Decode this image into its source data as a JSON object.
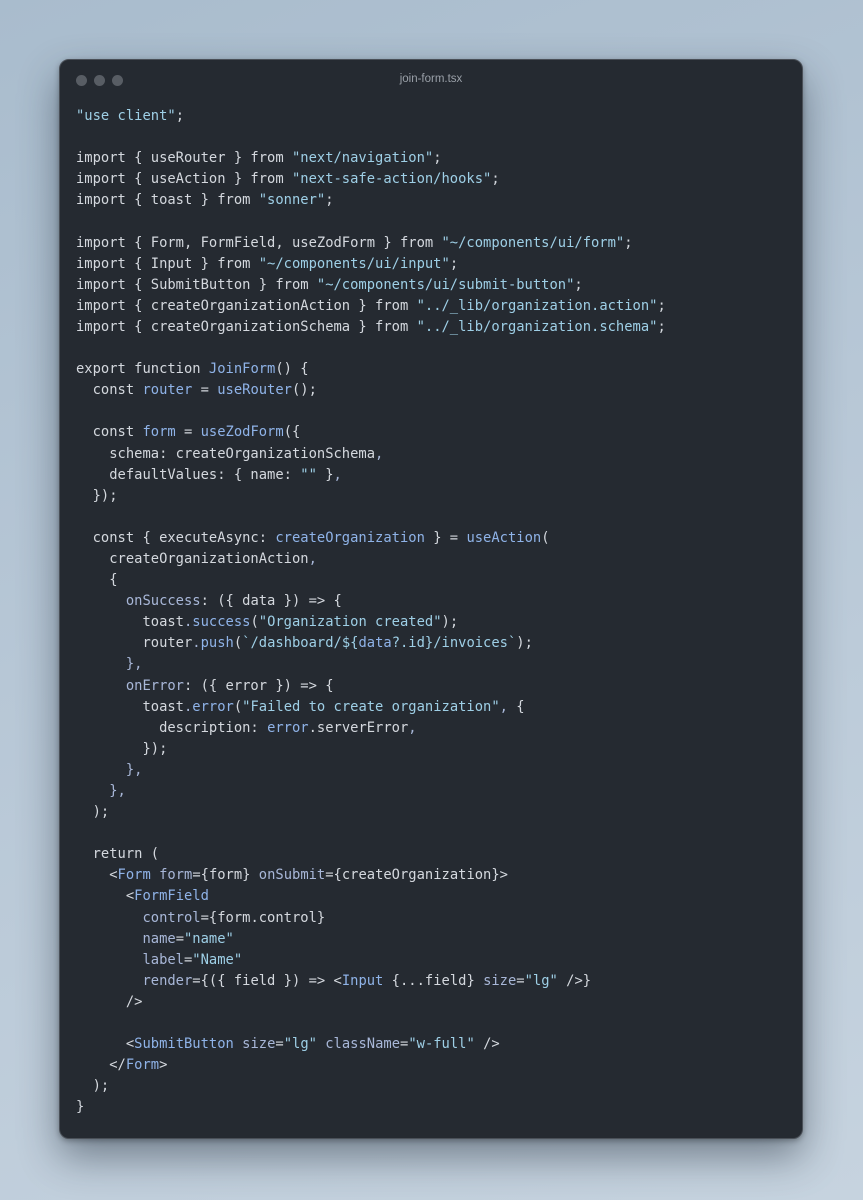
{
  "window": {
    "title": "join-form.tsx"
  },
  "colors": {
    "background": "#b7c7d6",
    "editor": "#252a31",
    "text": "#d4d8de",
    "string": "#9ecfe6",
    "function": "#8fb3e8",
    "property": "#a8b7d8"
  },
  "code_lines": [
    [
      [
        "str",
        "\"use client\""
      ],
      [
        "punct",
        ";"
      ]
    ],
    [],
    [
      [
        "kw",
        "import { useRouter } from "
      ],
      [
        "str",
        "\"next/navigation\""
      ],
      [
        "punct",
        ";"
      ]
    ],
    [
      [
        "kw",
        "import { useAction } from "
      ],
      [
        "str",
        "\"next-safe-action/hooks\""
      ],
      [
        "punct",
        ";"
      ]
    ],
    [
      [
        "kw",
        "import { toast } from "
      ],
      [
        "str",
        "\"sonner\""
      ],
      [
        "punct",
        ";"
      ]
    ],
    [],
    [
      [
        "kw",
        "import { Form, FormField, useZodForm } from "
      ],
      [
        "str",
        "\"~/components/ui/form\""
      ],
      [
        "punct",
        ";"
      ]
    ],
    [
      [
        "kw",
        "import { Input } from "
      ],
      [
        "str",
        "\"~/components/ui/input\""
      ],
      [
        "punct",
        ";"
      ]
    ],
    [
      [
        "kw",
        "import { SubmitButton } from "
      ],
      [
        "str",
        "\"~/components/ui/submit-button\""
      ],
      [
        "punct",
        ";"
      ]
    ],
    [
      [
        "kw",
        "import { createOrganizationAction } from "
      ],
      [
        "str",
        "\"../_lib/organization.action\""
      ],
      [
        "punct",
        ";"
      ]
    ],
    [
      [
        "kw",
        "import { createOrganizationSchema } from "
      ],
      [
        "str",
        "\"../_lib/organization.schema\""
      ],
      [
        "punct",
        ";"
      ]
    ],
    [],
    [
      [
        "kw",
        "export function "
      ],
      [
        "fn",
        "JoinForm"
      ],
      [
        "punct",
        "() {"
      ]
    ],
    [
      [
        "kw",
        "  const "
      ],
      [
        "fn",
        "router"
      ],
      [
        "punct",
        " = "
      ],
      [
        "fn",
        "useRouter"
      ],
      [
        "punct",
        "();"
      ]
    ],
    [],
    [
      [
        "kw",
        "  const "
      ],
      [
        "fn",
        "form"
      ],
      [
        "punct",
        " = "
      ],
      [
        "fn",
        "useZodForm"
      ],
      [
        "punct",
        "({"
      ]
    ],
    [
      [
        "kw",
        "    schema: createOrganizationSchema"
      ],
      [
        "prop",
        ","
      ]
    ],
    [
      [
        "kw",
        "    defaultValues: { name: "
      ],
      [
        "str",
        "\"\""
      ],
      [
        "punct",
        " }"
      ],
      [
        "prop",
        ","
      ]
    ],
    [
      [
        "punct",
        "  });"
      ]
    ],
    [],
    [
      [
        "kw",
        "  const { executeAsync: "
      ],
      [
        "fn",
        "createOrganization"
      ],
      [
        "punct",
        " } = "
      ],
      [
        "fn",
        "useAction"
      ],
      [
        "punct",
        "("
      ]
    ],
    [
      [
        "kw",
        "    createOrganizationAction"
      ],
      [
        "prop",
        ","
      ]
    ],
    [
      [
        "punct",
        "    {"
      ]
    ],
    [
      [
        "prop",
        "      onSuccess"
      ],
      [
        "punct",
        ": ({ data }) => {"
      ]
    ],
    [
      [
        "kw",
        "        toast"
      ],
      [
        "prop",
        "."
      ],
      [
        "fn",
        "success"
      ],
      [
        "punct",
        "("
      ],
      [
        "str",
        "\"Organization created\""
      ],
      [
        "punct",
        ");"
      ]
    ],
    [
      [
        "kw",
        "        router"
      ],
      [
        "prop",
        "."
      ],
      [
        "fn",
        "push"
      ],
      [
        "punct",
        "("
      ],
      [
        "str",
        "`/dashboard/${"
      ],
      [
        "fn",
        "data"
      ],
      [
        "str",
        "?.id}/invoices`"
      ],
      [
        "punct",
        ");"
      ]
    ],
    [
      [
        "prop",
        "      },"
      ]
    ],
    [
      [
        "prop",
        "      onError"
      ],
      [
        "punct",
        ": ({ error }) => {"
      ]
    ],
    [
      [
        "kw",
        "        toast"
      ],
      [
        "prop",
        "."
      ],
      [
        "fn",
        "error"
      ],
      [
        "punct",
        "("
      ],
      [
        "str",
        "\"Failed to create organization\""
      ],
      [
        "prop",
        ","
      ],
      [
        "punct",
        " {"
      ]
    ],
    [
      [
        "kw",
        "          description: "
      ],
      [
        "fn",
        "error"
      ],
      [
        "punct",
        ".serverError"
      ],
      [
        "prop",
        ","
      ]
    ],
    [
      [
        "punct",
        "        });"
      ]
    ],
    [
      [
        "prop",
        "      },"
      ]
    ],
    [
      [
        "prop",
        "    },"
      ]
    ],
    [
      [
        "punct",
        "  );"
      ]
    ],
    [],
    [
      [
        "kw",
        "  return ("
      ]
    ],
    [
      [
        "punct",
        "    <"
      ],
      [
        "fn",
        "Form"
      ],
      [
        "prop",
        " form"
      ],
      [
        "punct",
        "={form} "
      ],
      [
        "prop",
        "onSubmit"
      ],
      [
        "punct",
        "={createOrganization}>"
      ]
    ],
    [
      [
        "punct",
        "      <"
      ],
      [
        "fn",
        "FormField"
      ]
    ],
    [
      [
        "prop",
        "        control"
      ],
      [
        "punct",
        "={form.control}"
      ]
    ],
    [
      [
        "prop",
        "        name"
      ],
      [
        "punct",
        "="
      ],
      [
        "str",
        "\"name\""
      ]
    ],
    [
      [
        "prop",
        "        label"
      ],
      [
        "punct",
        "="
      ],
      [
        "str",
        "\"Name\""
      ]
    ],
    [
      [
        "prop",
        "        render"
      ],
      [
        "punct",
        "={({ field }) => <"
      ],
      [
        "fn",
        "Input"
      ],
      [
        "punct",
        " {...field} "
      ],
      [
        "prop",
        "size"
      ],
      [
        "punct",
        "="
      ],
      [
        "str",
        "\"lg\""
      ],
      [
        "punct",
        " />}"
      ]
    ],
    [
      [
        "punct",
        "      />"
      ]
    ],
    [],
    [
      [
        "punct",
        "      <"
      ],
      [
        "fn",
        "SubmitButton"
      ],
      [
        "prop",
        " size"
      ],
      [
        "punct",
        "="
      ],
      [
        "str",
        "\"lg\""
      ],
      [
        "prop",
        " className"
      ],
      [
        "punct",
        "="
      ],
      [
        "str",
        "\"w-full\""
      ],
      [
        "punct",
        " />"
      ]
    ],
    [
      [
        "punct",
        "    </"
      ],
      [
        "fn",
        "Form"
      ],
      [
        "punct",
        ">"
      ]
    ],
    [
      [
        "punct",
        "  );"
      ]
    ],
    [
      [
        "punct",
        "}"
      ]
    ]
  ]
}
